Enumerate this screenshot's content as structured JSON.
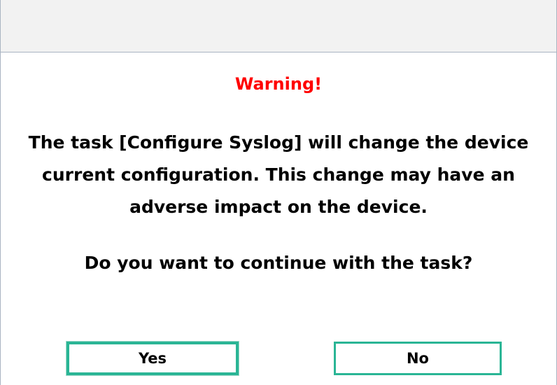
{
  "dialog": {
    "warning_title": "Warning!",
    "message_lines": [
      "The task [Configure Syslog] will change the device",
      "current configuration. This change may have an",
      "adverse impact on the device."
    ],
    "question": "Do you want to continue with the task?",
    "yes_label": "Yes",
    "no_label": "No"
  },
  "colors": {
    "warning": "#ff0000",
    "button_border": "#2ab595",
    "titlebar": "#f2f2f2"
  }
}
